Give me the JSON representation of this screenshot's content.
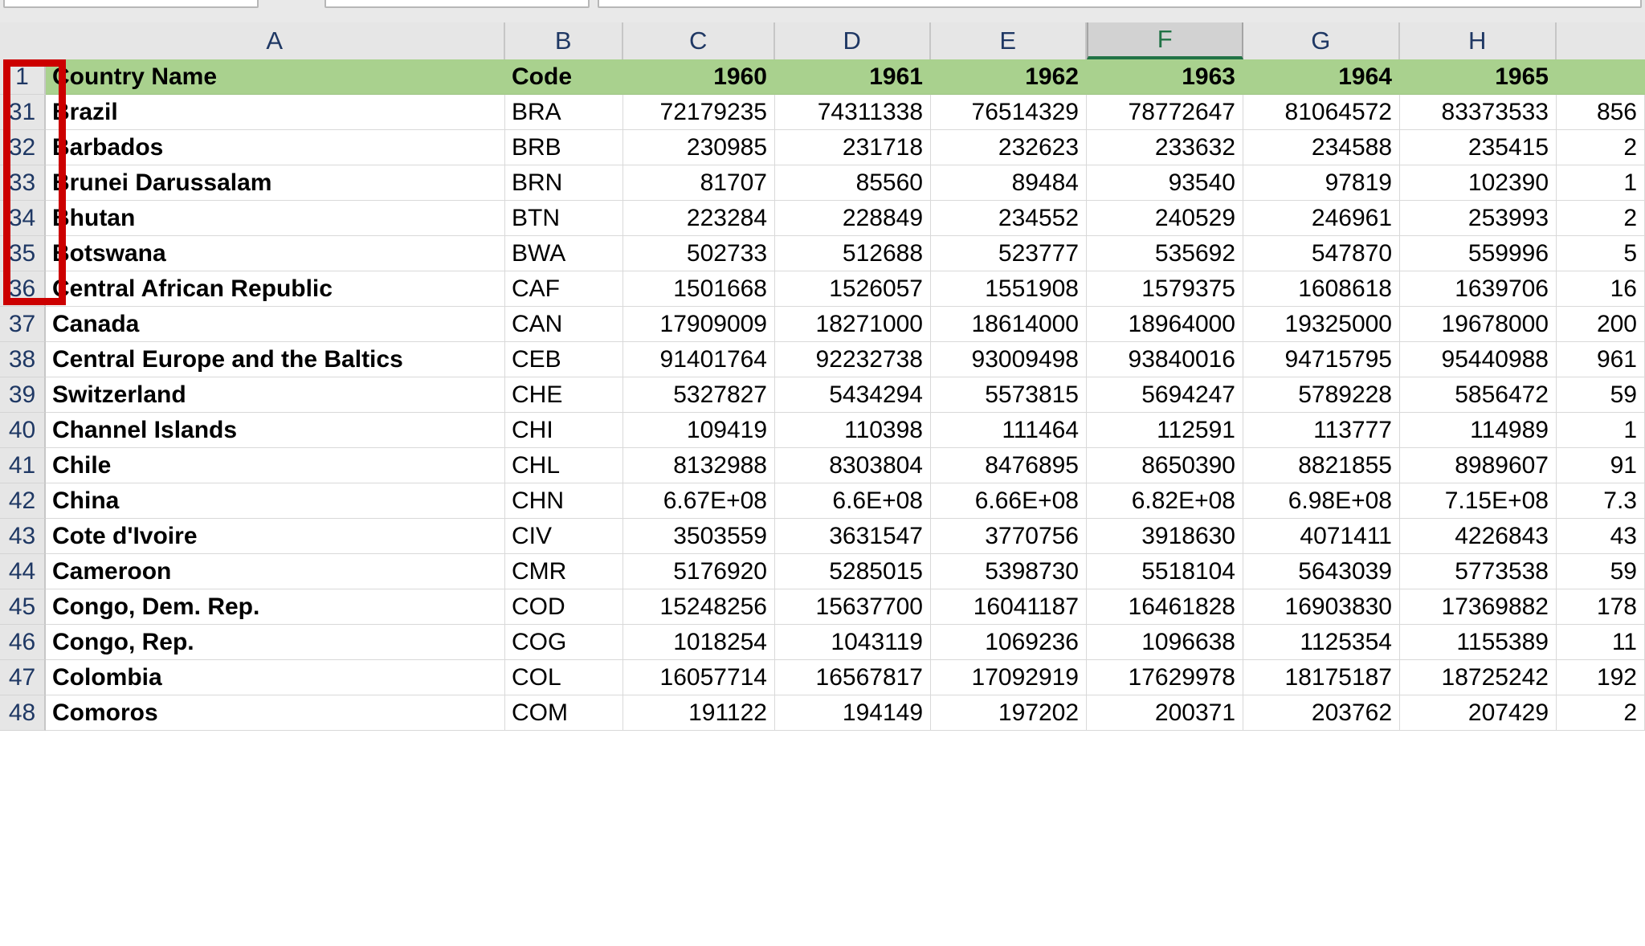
{
  "app": {
    "name_box_value": "",
    "formula_bar_value": ""
  },
  "grid": {
    "column_headers": [
      "A",
      "B",
      "C",
      "D",
      "E",
      "F",
      "G",
      "H"
    ],
    "selected_column": "F",
    "row_headers": [
      "1",
      "31",
      "32",
      "33",
      "34",
      "35",
      "36",
      "37",
      "38",
      "39",
      "40",
      "41",
      "42",
      "43",
      "44",
      "45",
      "46",
      "47",
      "48"
    ],
    "header_fill_color": "#a9d18e",
    "column_header_fill_color": "#e6e6e6",
    "selected_column_fill_color": "#d2d2d2",
    "selected_column_accent_color": "#217346",
    "annotation_color": "#cc0000",
    "annotation_label": "row-header-highlight"
  },
  "table": {
    "columns": [
      "Country Name",
      "Code",
      "1960",
      "1961",
      "1962",
      "1963",
      "1964",
      "1965",
      ""
    ],
    "rows": [
      {
        "row": "31",
        "name": "Brazil",
        "code": "BRA",
        "v1960": "72179235",
        "v1961": "74311338",
        "v1962": "76514329",
        "v1963": "78772647",
        "v1964": "81064572",
        "v1965": "83373533",
        "v1966": "856"
      },
      {
        "row": "32",
        "name": "Barbados",
        "code": "BRB",
        "v1960": "230985",
        "v1961": "231718",
        "v1962": "232623",
        "v1963": "233632",
        "v1964": "234588",
        "v1965": "235415",
        "v1966": "2"
      },
      {
        "row": "33",
        "name": "Brunei Darussalam",
        "code": "BRN",
        "v1960": "81707",
        "v1961": "85560",
        "v1962": "89484",
        "v1963": "93540",
        "v1964": "97819",
        "v1965": "102390",
        "v1966": "1"
      },
      {
        "row": "34",
        "name": "Bhutan",
        "code": "BTN",
        "v1960": "223284",
        "v1961": "228849",
        "v1962": "234552",
        "v1963": "240529",
        "v1964": "246961",
        "v1965": "253993",
        "v1966": "2"
      },
      {
        "row": "35",
        "name": "Botswana",
        "code": "BWA",
        "v1960": "502733",
        "v1961": "512688",
        "v1962": "523777",
        "v1963": "535692",
        "v1964": "547870",
        "v1965": "559996",
        "v1966": "5"
      },
      {
        "row": "36",
        "name": "Central African Republic",
        "code": "CAF",
        "v1960": "1501668",
        "v1961": "1526057",
        "v1962": "1551908",
        "v1963": "1579375",
        "v1964": "1608618",
        "v1965": "1639706",
        "v1966": "16"
      },
      {
        "row": "37",
        "name": "Canada",
        "code": "CAN",
        "v1960": "17909009",
        "v1961": "18271000",
        "v1962": "18614000",
        "v1963": "18964000",
        "v1964": "19325000",
        "v1965": "19678000",
        "v1966": "200"
      },
      {
        "row": "38",
        "name": "Central Europe and the Baltics",
        "code": "CEB",
        "v1960": "91401764",
        "v1961": "92232738",
        "v1962": "93009498",
        "v1963": "93840016",
        "v1964": "94715795",
        "v1965": "95440988",
        "v1966": "961"
      },
      {
        "row": "39",
        "name": "Switzerland",
        "code": "CHE",
        "v1960": "5327827",
        "v1961": "5434294",
        "v1962": "5573815",
        "v1963": "5694247",
        "v1964": "5789228",
        "v1965": "5856472",
        "v1966": "59"
      },
      {
        "row": "40",
        "name": "Channel Islands",
        "code": "CHI",
        "v1960": "109419",
        "v1961": "110398",
        "v1962": "111464",
        "v1963": "112591",
        "v1964": "113777",
        "v1965": "114989",
        "v1966": "1"
      },
      {
        "row": "41",
        "name": "Chile",
        "code": "CHL",
        "v1960": "8132988",
        "v1961": "8303804",
        "v1962": "8476895",
        "v1963": "8650390",
        "v1964": "8821855",
        "v1965": "8989607",
        "v1966": "91"
      },
      {
        "row": "42",
        "name": "China",
        "code": "CHN",
        "v1960": "6.67E+08",
        "v1961": "6.6E+08",
        "v1962": "6.66E+08",
        "v1963": "6.82E+08",
        "v1964": "6.98E+08",
        "v1965": "7.15E+08",
        "v1966": "7.3"
      },
      {
        "row": "43",
        "name": "Cote d'Ivoire",
        "code": "CIV",
        "v1960": "3503559",
        "v1961": "3631547",
        "v1962": "3770756",
        "v1963": "3918630",
        "v1964": "4071411",
        "v1965": "4226843",
        "v1966": "43"
      },
      {
        "row": "44",
        "name": "Cameroon",
        "code": "CMR",
        "v1960": "5176920",
        "v1961": "5285015",
        "v1962": "5398730",
        "v1963": "5518104",
        "v1964": "5643039",
        "v1965": "5773538",
        "v1966": "59"
      },
      {
        "row": "45",
        "name": "Congo, Dem. Rep.",
        "code": "COD",
        "v1960": "15248256",
        "v1961": "15637700",
        "v1962": "16041187",
        "v1963": "16461828",
        "v1964": "16903830",
        "v1965": "17369882",
        "v1966": "178"
      },
      {
        "row": "46",
        "name": "Congo, Rep.",
        "code": "COG",
        "v1960": "1018254",
        "v1961": "1043119",
        "v1962": "1069236",
        "v1963": "1096638",
        "v1964": "1125354",
        "v1965": "1155389",
        "v1966": "11"
      },
      {
        "row": "47",
        "name": "Colombia",
        "code": "COL",
        "v1960": "16057714",
        "v1961": "16567817",
        "v1962": "17092919",
        "v1963": "17629978",
        "v1964": "18175187",
        "v1965": "18725242",
        "v1966": "192"
      },
      {
        "row": "48",
        "name": "Comoros",
        "code": "COM",
        "v1960": "191122",
        "v1961": "194149",
        "v1962": "197202",
        "v1963": "200371",
        "v1964": "203762",
        "v1965": "207429",
        "v1966": "2"
      }
    ]
  }
}
